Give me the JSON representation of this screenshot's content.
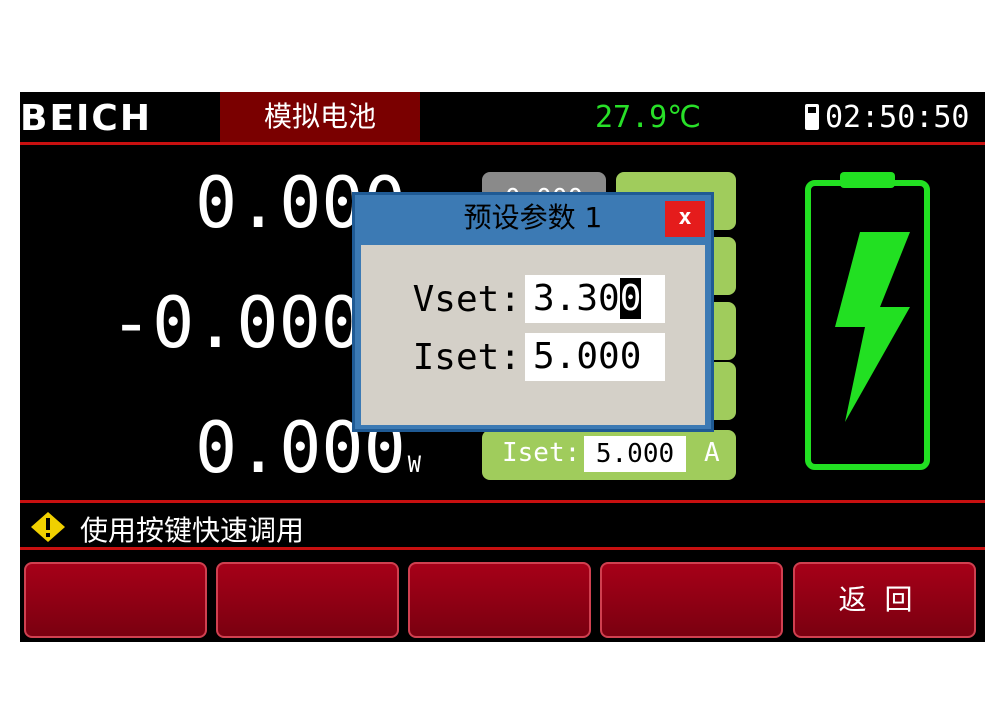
{
  "header": {
    "logo": "BEICH",
    "mode": "模拟电池",
    "temperature": "27.9℃",
    "clock": "02:50:50",
    "icon": "usb-drive-icon"
  },
  "readings": {
    "voltage": "0.000",
    "current": "-0.000",
    "power": "0.000",
    "power_unit": "W"
  },
  "presets": {
    "gray_value": "0.000",
    "iset_label": "Iset:",
    "iset_value": "5.000",
    "iset_unit": "A"
  },
  "dialog": {
    "title": "预设参数 1",
    "close_label": "x",
    "vset_label": "Vset:",
    "vset_value_prefix": "3.30",
    "vset_value_cursor": "0",
    "iset_label": "Iset:",
    "iset_value": "5.000"
  },
  "status": {
    "hint": "使用按键快速调用",
    "icon": "info-icon"
  },
  "function_keys": [
    "",
    "",
    "",
    "",
    "返回"
  ],
  "colors": {
    "accent_red": "#c81010",
    "battery_green": "#22e022",
    "temp_green": "#28e028",
    "dialog_blue": "#3c7ab4"
  }
}
